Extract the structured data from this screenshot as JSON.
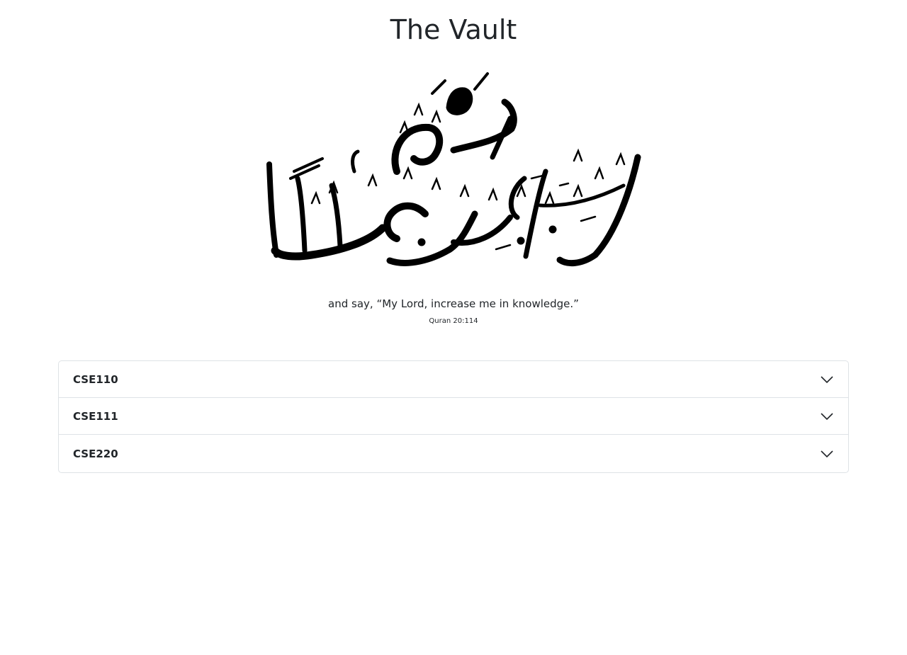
{
  "header": {
    "title": "The Vault"
  },
  "hero": {
    "calligraphy_text": "وقل رب زدني علما",
    "quote": "and say, “My Lord, increase me in knowledge.”",
    "citation": "Quran 20:114"
  },
  "accordion": {
    "items": [
      {
        "label": "CSE110",
        "icon": "chevron-down-icon"
      },
      {
        "label": "CSE111",
        "icon": "chevron-down-icon"
      },
      {
        "label": "CSE220",
        "icon": "chevron-down-icon"
      }
    ]
  }
}
